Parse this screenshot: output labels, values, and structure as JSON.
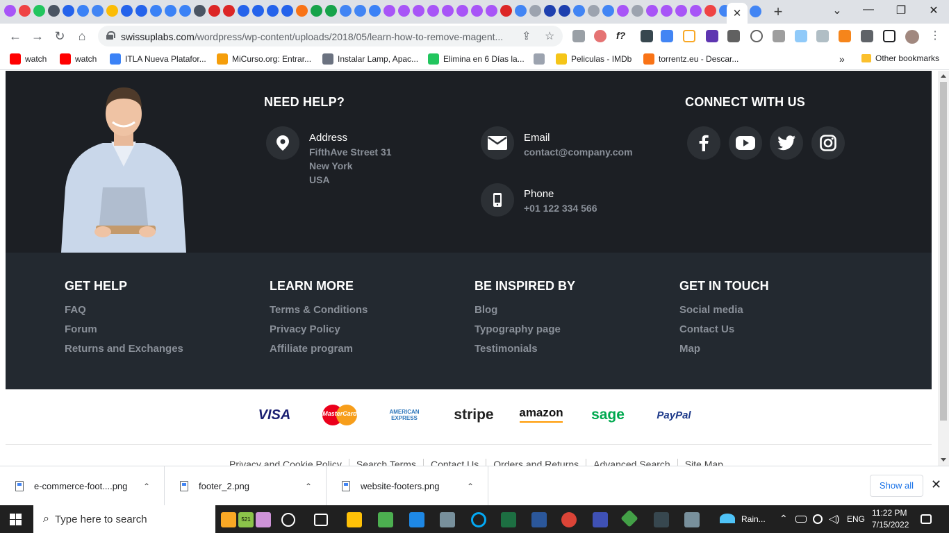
{
  "browser": {
    "active_tab_close": "✕",
    "new_tab": "+",
    "url_domain": "swissuplabs.com",
    "url_path": "/wordpress/wp-content/uploads/2018/05/learn-how-to-remove-magent...",
    "bookmarks": [
      {
        "label": "watch",
        "color": "#ff0000"
      },
      {
        "label": "watch",
        "color": "#ff0000"
      },
      {
        "label": "ITLA Nueva Platafor...",
        "color": "#3b82f6"
      },
      {
        "label": "MiCurso.org: Entrar...",
        "color": "#f59e0b"
      },
      {
        "label": "Instalar Lamp, Apac...",
        "color": "#6b7280"
      },
      {
        "label": "Elimina en 6 Días la...",
        "color": "#22c55e"
      },
      {
        "label": "",
        "color": "#9ca3af"
      },
      {
        "label": "Peliculas - IMDb",
        "color": "#f5c518"
      },
      {
        "label": "torrentz.eu - Descar...",
        "color": "#f97316"
      }
    ],
    "bookmarks_overflow": "»",
    "other_bookmarks": "Other bookmarks"
  },
  "footer": {
    "help_title": "NEED HELP?",
    "connect_title": "CONNECT WITH US",
    "address_label": "Address",
    "address_lines": [
      "FifthAve Street 31",
      "New York",
      "USA"
    ],
    "email_label": "Email",
    "email_value": "contact@company.com",
    "phone_label": "Phone",
    "phone_value": "+01 122 334 566",
    "columns": [
      {
        "title": "GET HELP",
        "links": [
          "FAQ",
          "Forum",
          "Returns and Exchanges"
        ]
      },
      {
        "title": "LEARN MORE",
        "links": [
          "Terms & Conditions",
          "Privacy Policy",
          "Affiliate program"
        ]
      },
      {
        "title": "BE INSPIRED BY",
        "links": [
          "Blog",
          "Typography page",
          "Testimonials"
        ]
      },
      {
        "title": "GET IN TOUCH",
        "links": [
          "Social media",
          "Contact Us",
          "Map"
        ]
      }
    ],
    "payments": [
      "VISA",
      "MasterCard",
      "AMERICAN EXPRESS",
      "stripe",
      "amazon",
      "sage",
      "PayPal"
    ],
    "bottom_links": [
      "Privacy and Cookie Policy",
      "Search Terms",
      "Contact Us",
      "Orders and Returns",
      "Advanced Search",
      "Site Map"
    ]
  },
  "downloads": {
    "items": [
      "e-commerce-foot....png",
      "footer_2.png",
      "website-footers.png"
    ],
    "show_all": "Show all"
  },
  "taskbar": {
    "search_placeholder": "Type here to search",
    "badge": "521",
    "weather": "Rain...",
    "lang": "ENG",
    "time": "11:22 PM",
    "date": "7/15/2022"
  },
  "colors": {
    "footer_dark": "#1c1f24",
    "footer_mid": "#232930",
    "muted_text": "#8a9099"
  }
}
